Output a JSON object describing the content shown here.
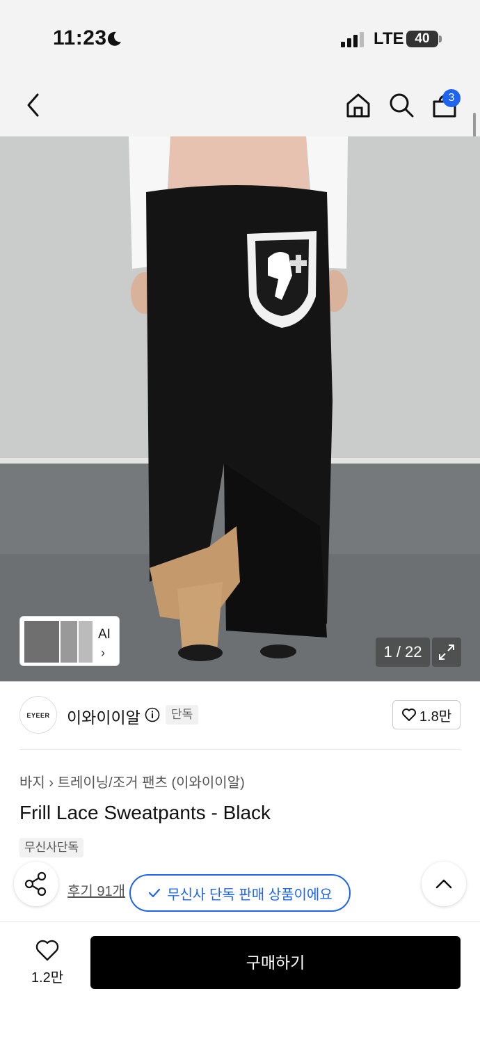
{
  "status_bar": {
    "time": "11:23",
    "network": "LTE",
    "battery": "40"
  },
  "nav": {
    "cart_count": "3"
  },
  "gallery": {
    "ai_label": "AI",
    "counter": "1 / 22"
  },
  "brand": {
    "logo_text": "EYEER",
    "name": "이와이이알",
    "tag": "단독",
    "like_count": "1.8만"
  },
  "product": {
    "breadcrumb": "바지 › 트레이닝/조거 팬츠 (이와이이알)",
    "title": "Frill Lace Sweatpants - Black",
    "tag": "무신사단독",
    "review_text": "후기 91개"
  },
  "toast": {
    "text": "무신사 단독 판매 상품이에요"
  },
  "bottom_bar": {
    "wish_count": "1.2만",
    "buy_label": "구매하기"
  },
  "colors": {
    "accent": "#1e64f0",
    "buy_button": "#000000"
  }
}
